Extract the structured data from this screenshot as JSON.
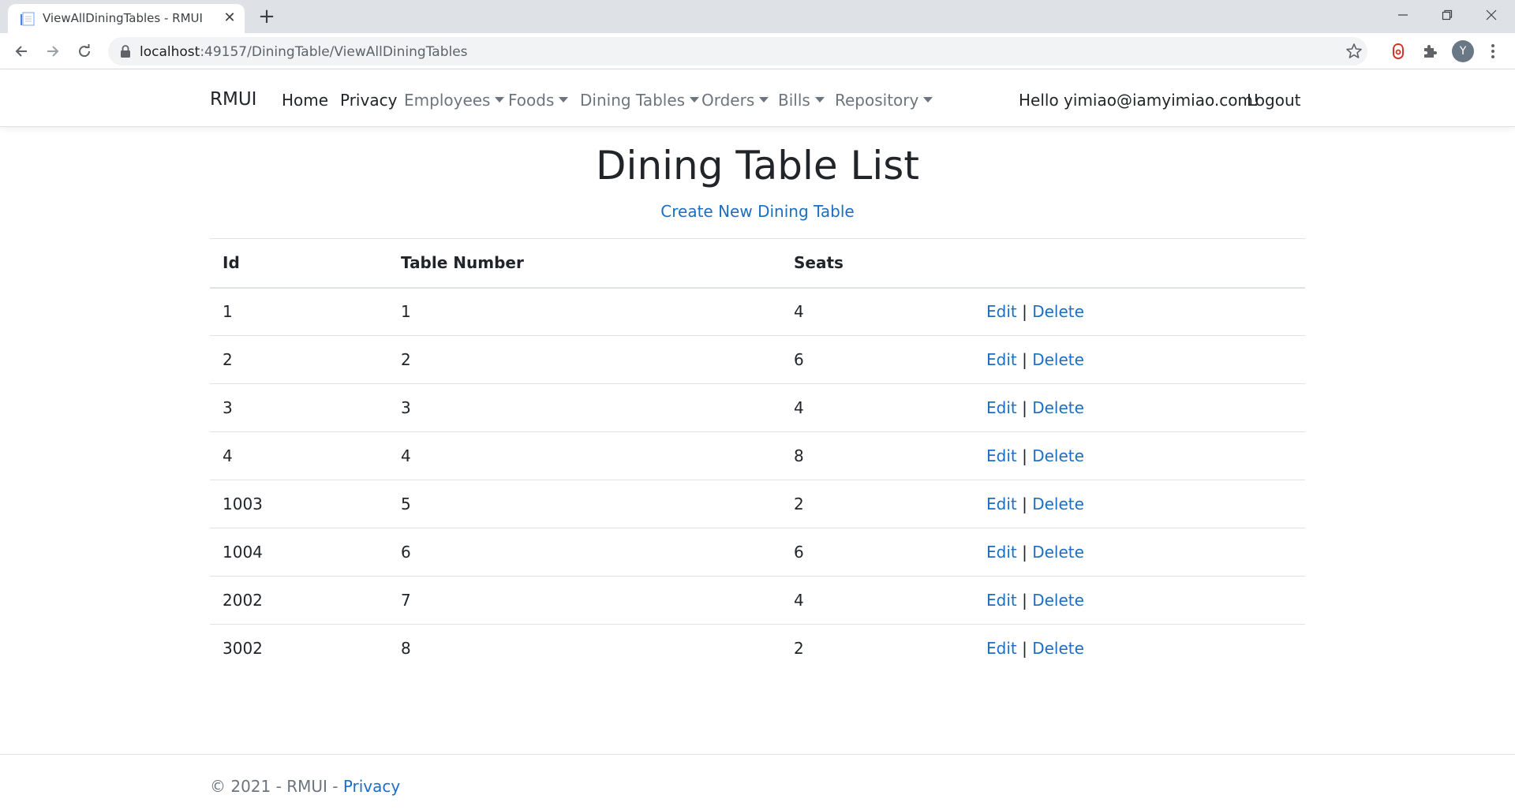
{
  "browser": {
    "tab_title": "ViewAllDiningTables - RMUI",
    "url_host": "localhost",
    "url_path": ":49157/DiningTable/ViewAllDiningTables",
    "avatar_letter": "Y"
  },
  "navbar": {
    "brand": "RMUI",
    "links": [
      "Home",
      "Privacy"
    ],
    "dropdowns": [
      "Employees",
      "Foods",
      "Dining Tables",
      "Orders",
      "Bills",
      "Repository"
    ],
    "greeting": "Hello yimiao@iamyimiao.com!",
    "logout": "Logout"
  },
  "main": {
    "title": "Dining Table List",
    "create_link": "Create New Dining Table",
    "columns": [
      "Id",
      "Table Number",
      "Seats"
    ],
    "rows": [
      {
        "id": "1",
        "table_number": "1",
        "seats": "4"
      },
      {
        "id": "2",
        "table_number": "2",
        "seats": "6"
      },
      {
        "id": "3",
        "table_number": "3",
        "seats": "4"
      },
      {
        "id": "4",
        "table_number": "4",
        "seats": "8"
      },
      {
        "id": "1003",
        "table_number": "5",
        "seats": "2"
      },
      {
        "id": "1004",
        "table_number": "6",
        "seats": "6"
      },
      {
        "id": "2002",
        "table_number": "7",
        "seats": "4"
      },
      {
        "id": "3002",
        "table_number": "8",
        "seats": "2"
      }
    ],
    "edit_label": "Edit",
    "separator": "|",
    "delete_label": "Delete"
  },
  "footer": {
    "copyright": "© 2021 - RMUI - ",
    "privacy": "Privacy"
  },
  "colors": {
    "link": "#1b6ec2",
    "muted": "#6c757d",
    "text": "#212529"
  }
}
